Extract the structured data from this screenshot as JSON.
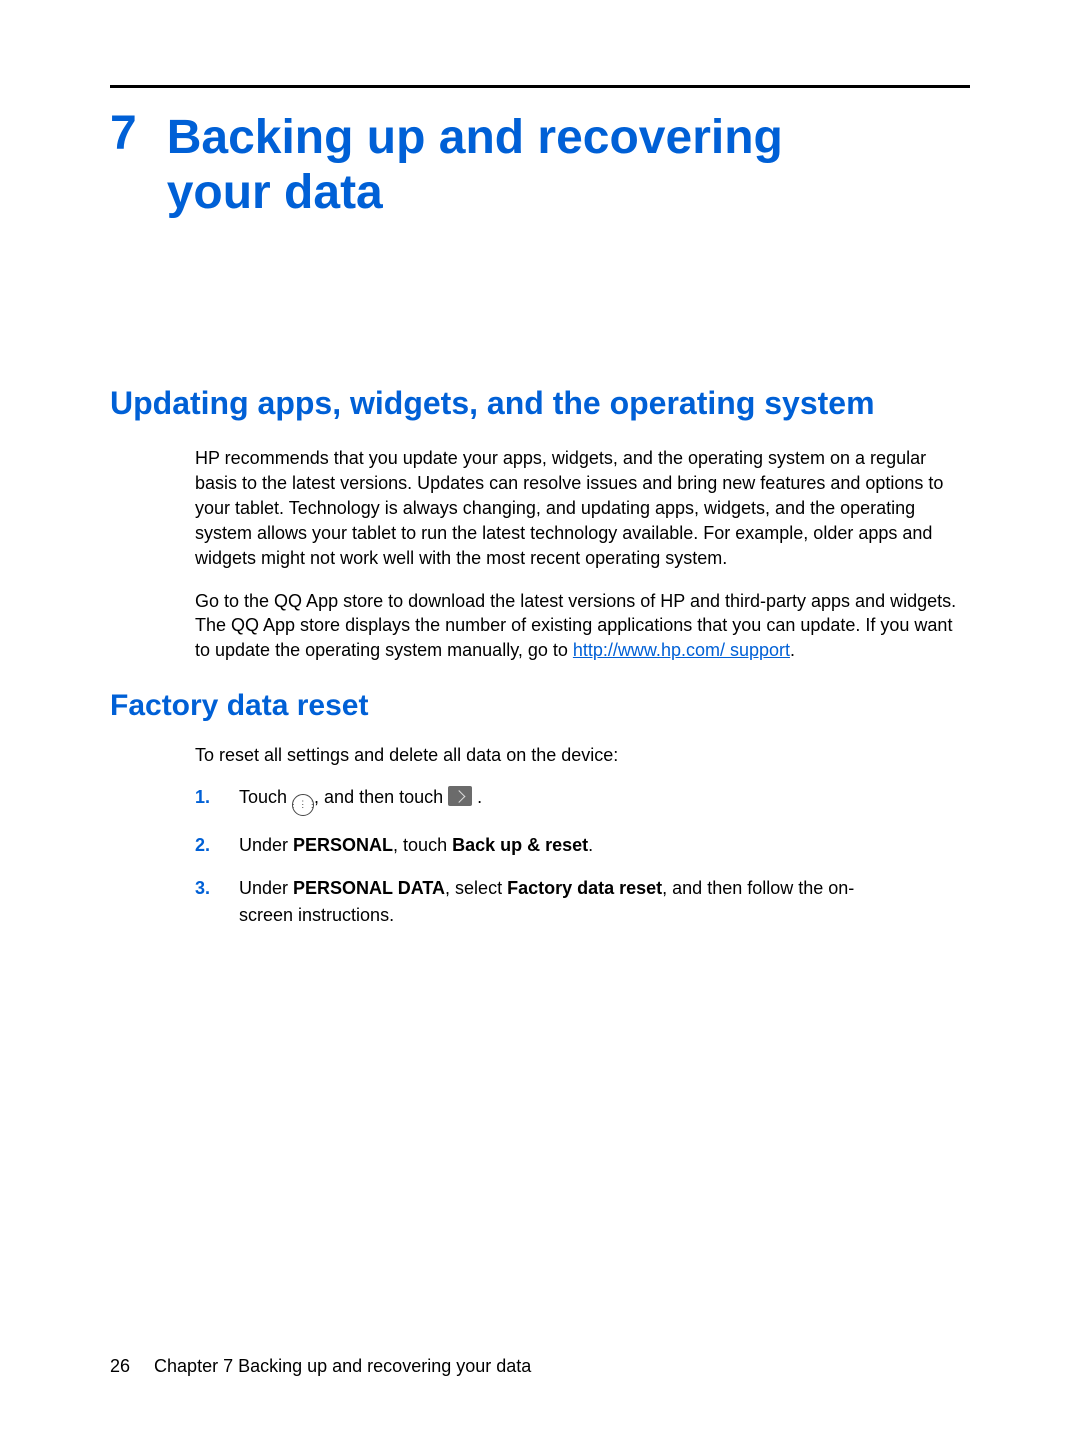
{
  "chapter": {
    "number": "7",
    "title": "Backing up and recovering your data"
  },
  "section1": {
    "heading": "Updating apps, widgets, and the operating system",
    "para1": "HP recommends that you update your apps, widgets, and the operating system on a regular basis to the latest versions. Updates can resolve issues and bring new features and options to your tablet. Technology is always changing, and updating apps, widgets, and the operating system allows your tablet to run the latest technology available. For example, older apps and widgets might not work well with the most recent operating system.",
    "para2_a": "Go to the QQ App store to download the latest versions of HP and third-party apps and widgets. The QQ App store displays the number of existing applications that you can update. If you want to update the operating system manually, go to ",
    "para2_link": "http://www.hp.com/ support",
    "para2_b": "."
  },
  "section2": {
    "heading": "Factory data reset",
    "intro": "To reset all settings and delete all data on the device:",
    "steps": [
      {
        "num": "1.",
        "pre": "Touch ",
        "mid": ", and then touch ",
        "post": " ."
      },
      {
        "num": "2.",
        "t1": "Under ",
        "b1": "PERSONAL",
        "t2": ", touch ",
        "b2": "Back up & reset",
        "t3": "."
      },
      {
        "num": "3.",
        "t1": "Under ",
        "b1": "PERSONAL DATA",
        "t2": ", select ",
        "b2": "Factory data reset",
        "t3": ", and then follow the on-screen instructions."
      }
    ]
  },
  "footer": {
    "page": "26",
    "text": "Chapter 7   Backing up and recovering your data"
  }
}
